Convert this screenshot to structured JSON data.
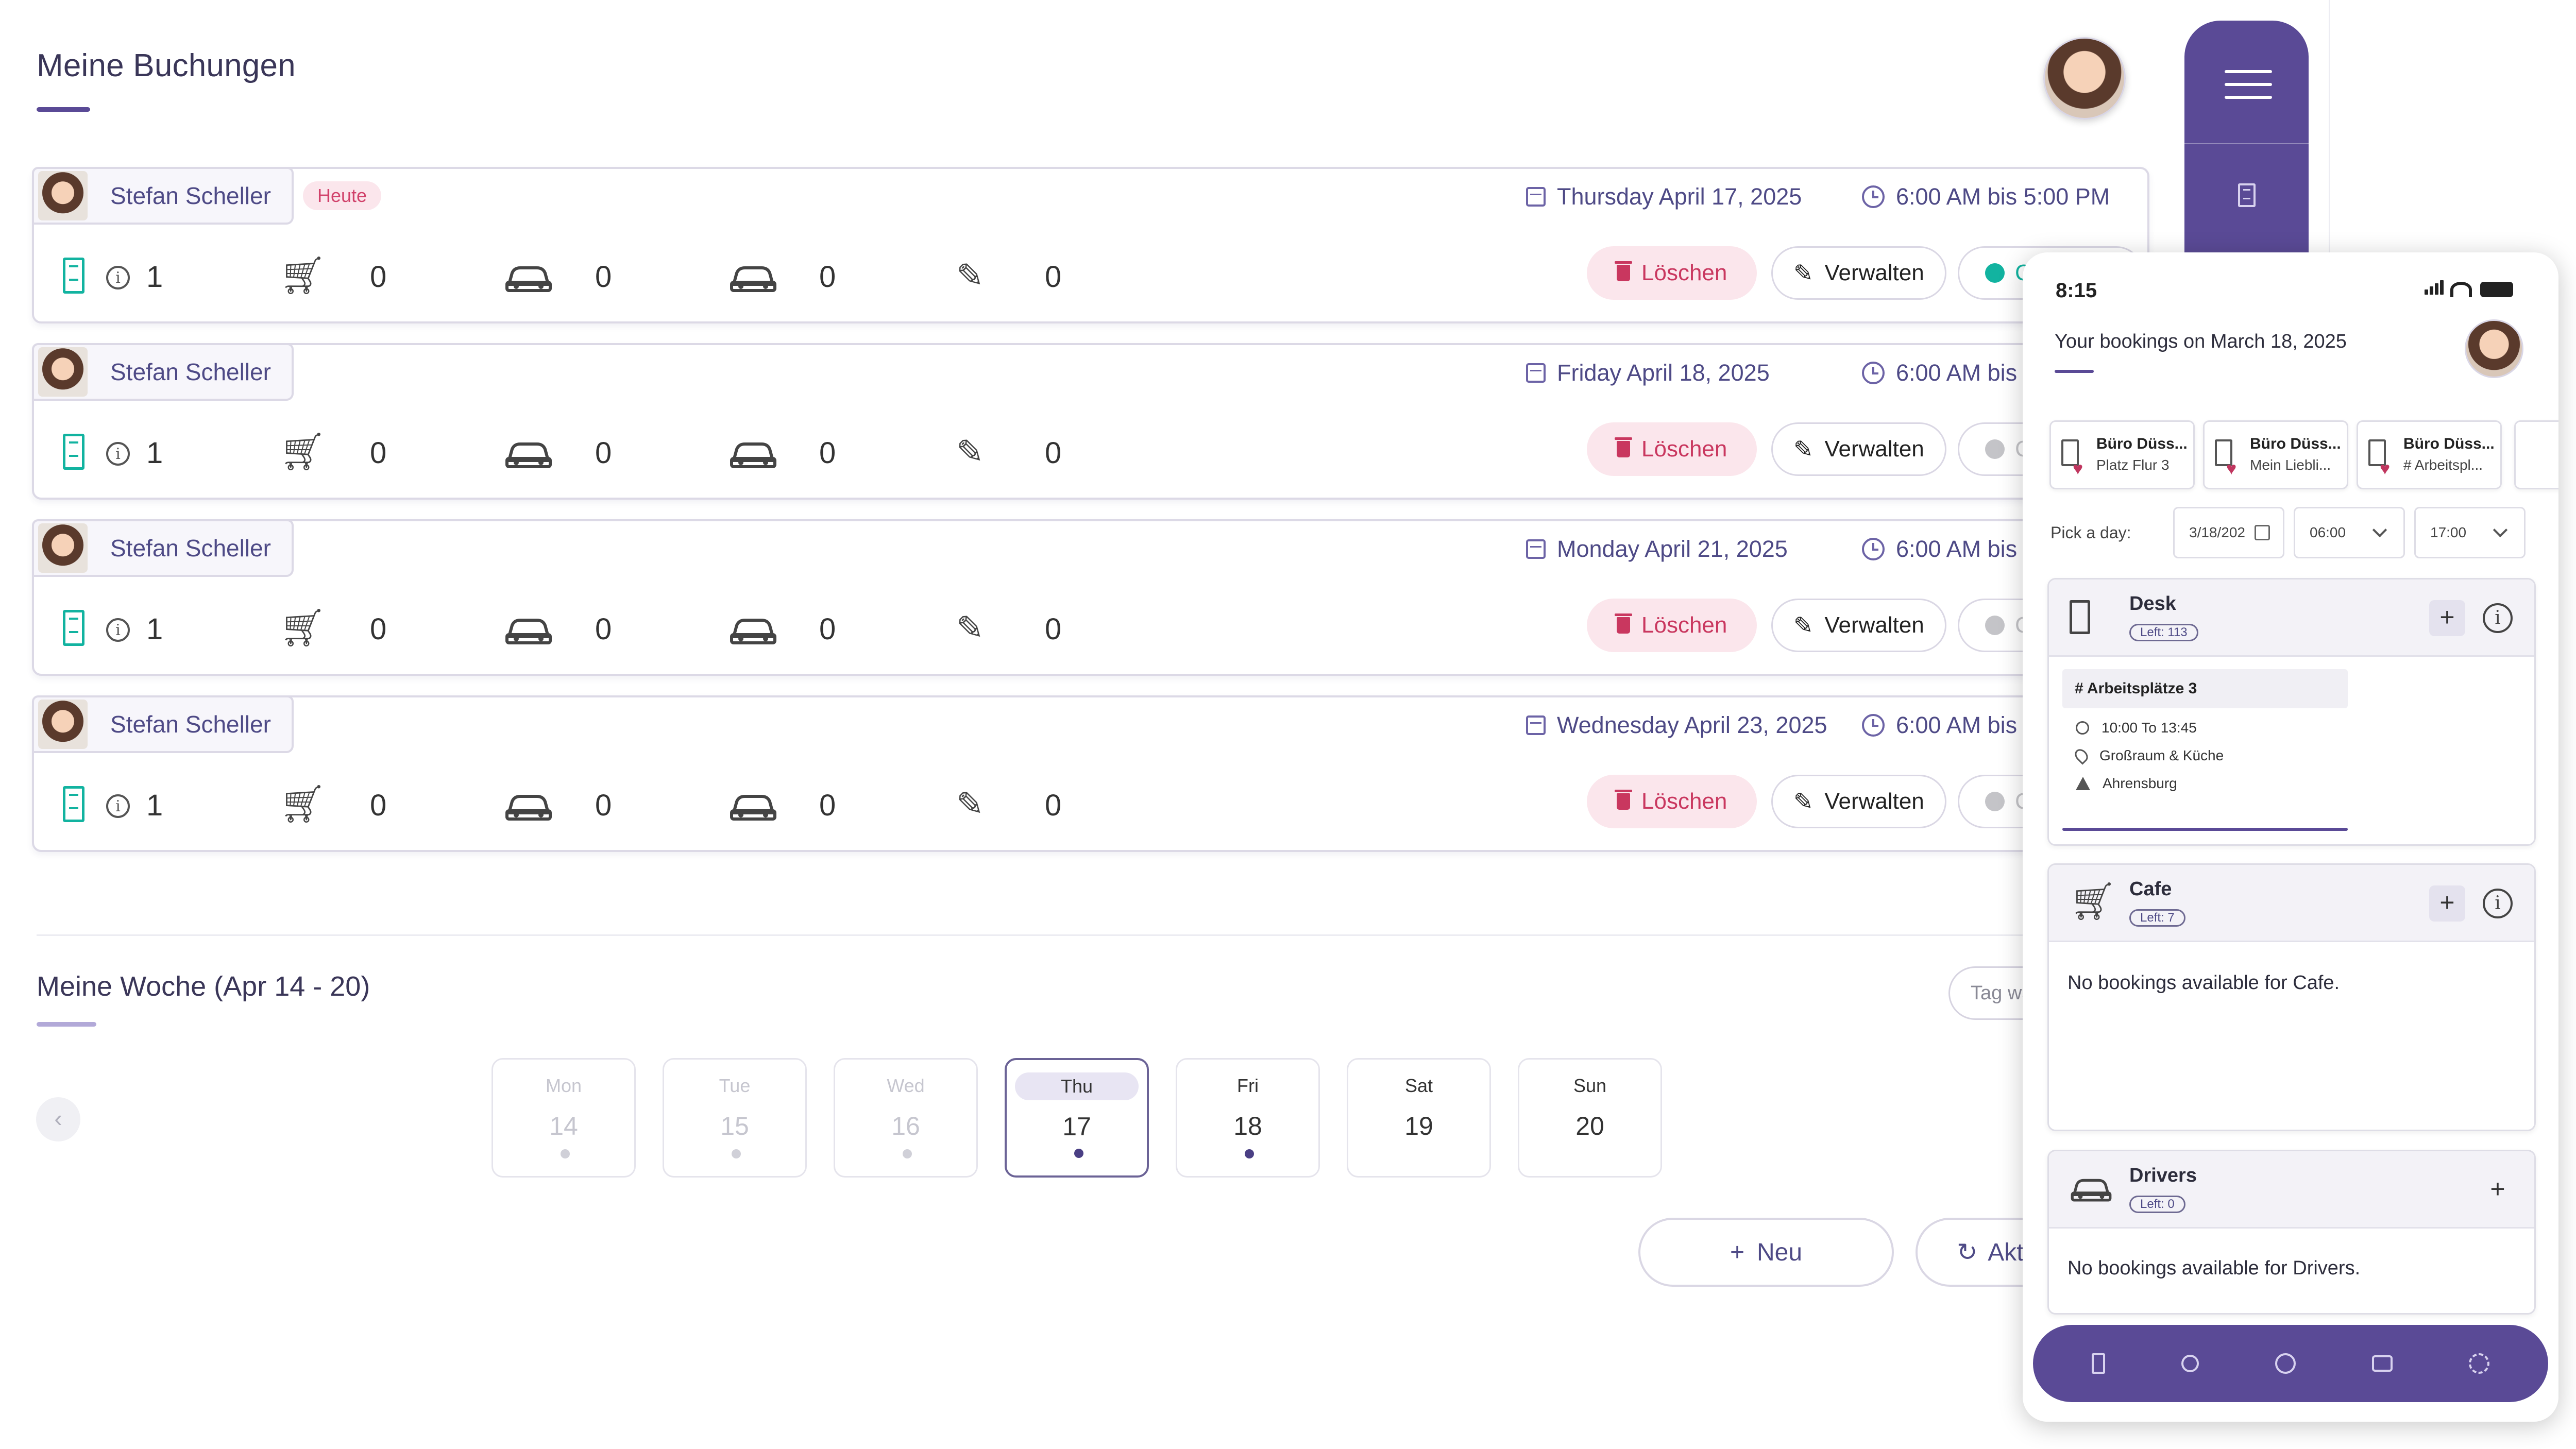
{
  "page": {
    "title": "Meine Buchungen"
  },
  "bookings": [
    {
      "user": "Stefan Scheller",
      "badge": "Heute",
      "date": "Thursday April 17, 2025",
      "time": "6:00 AM bis 5:00 PM",
      "desk_count": "1",
      "cafe_count": "0",
      "drivers_count": "0",
      "parking_count": "0",
      "other_count": "0",
      "delete_label": "Löschen",
      "manage_label": "Verwalten",
      "checkin_label": "Ch"
    },
    {
      "user": "Stefan Scheller",
      "date": "Friday April 18, 2025",
      "time": "6:00 AM bis",
      "desk_count": "1",
      "cafe_count": "0",
      "drivers_count": "0",
      "parking_count": "0",
      "other_count": "0",
      "delete_label": "Löschen",
      "manage_label": "Verwalten",
      "checkin_label": "C"
    },
    {
      "user": "Stefan Scheller",
      "date": "Monday April 21, 2025",
      "time": "6:00 AM bis",
      "desk_count": "1",
      "cafe_count": "0",
      "drivers_count": "0",
      "parking_count": "0",
      "other_count": "0",
      "delete_label": "Löschen",
      "manage_label": "Verwalten",
      "checkin_label": "C"
    },
    {
      "user": "Stefan Scheller",
      "date": "Wednesday April 23, 2025",
      "time": "6:00 AM bis",
      "desk_count": "1",
      "cafe_count": "0",
      "drivers_count": "0",
      "parking_count": "0",
      "other_count": "0",
      "delete_label": "Löschen",
      "manage_label": "Verwalten",
      "checkin_label": "C"
    }
  ],
  "week": {
    "title": "Meine Woche (Apr 14 - 20)",
    "tag_placeholder": "Tag wä",
    "days": [
      {
        "name": "Mon",
        "num": "14"
      },
      {
        "name": "Tue",
        "num": "15"
      },
      {
        "name": "Wed",
        "num": "16"
      },
      {
        "name": "Thu",
        "num": "17"
      },
      {
        "name": "Fri",
        "num": "18"
      },
      {
        "name": "Sat",
        "num": "19"
      },
      {
        "name": "Sun",
        "num": "20"
      }
    ],
    "new_label": "Neu",
    "refresh_label": "Akt"
  },
  "phone": {
    "time": "8:15",
    "title": "Your bookings on March 18, 2025",
    "locations": [
      {
        "line1": "Büro Düss...",
        "line2": "Platz Flur 3"
      },
      {
        "line1": "Büro Düss...",
        "line2": "Mein Liebli..."
      },
      {
        "line1": "Büro Düss...",
        "line2": "# Arbeitspl..."
      }
    ],
    "pick_label": "Pick a day:",
    "pick_date": "3/18/202",
    "pick_from": "06:00",
    "pick_to": "17:00",
    "sections": {
      "desk": {
        "name": "Desk",
        "left": "Left: 113",
        "booking": {
          "title": "# Arbeitsplätze 3",
          "time": "10:00 To 13:45",
          "room": "Großraum & Küche",
          "city": "Ahrensburg"
        }
      },
      "cafe": {
        "name": "Cafe",
        "left": "Left: 7",
        "empty": "No bookings available for Cafe."
      },
      "drivers": {
        "name": "Drivers",
        "left": "Left: 0",
        "empty": "No bookings available for Drivers."
      }
    }
  }
}
